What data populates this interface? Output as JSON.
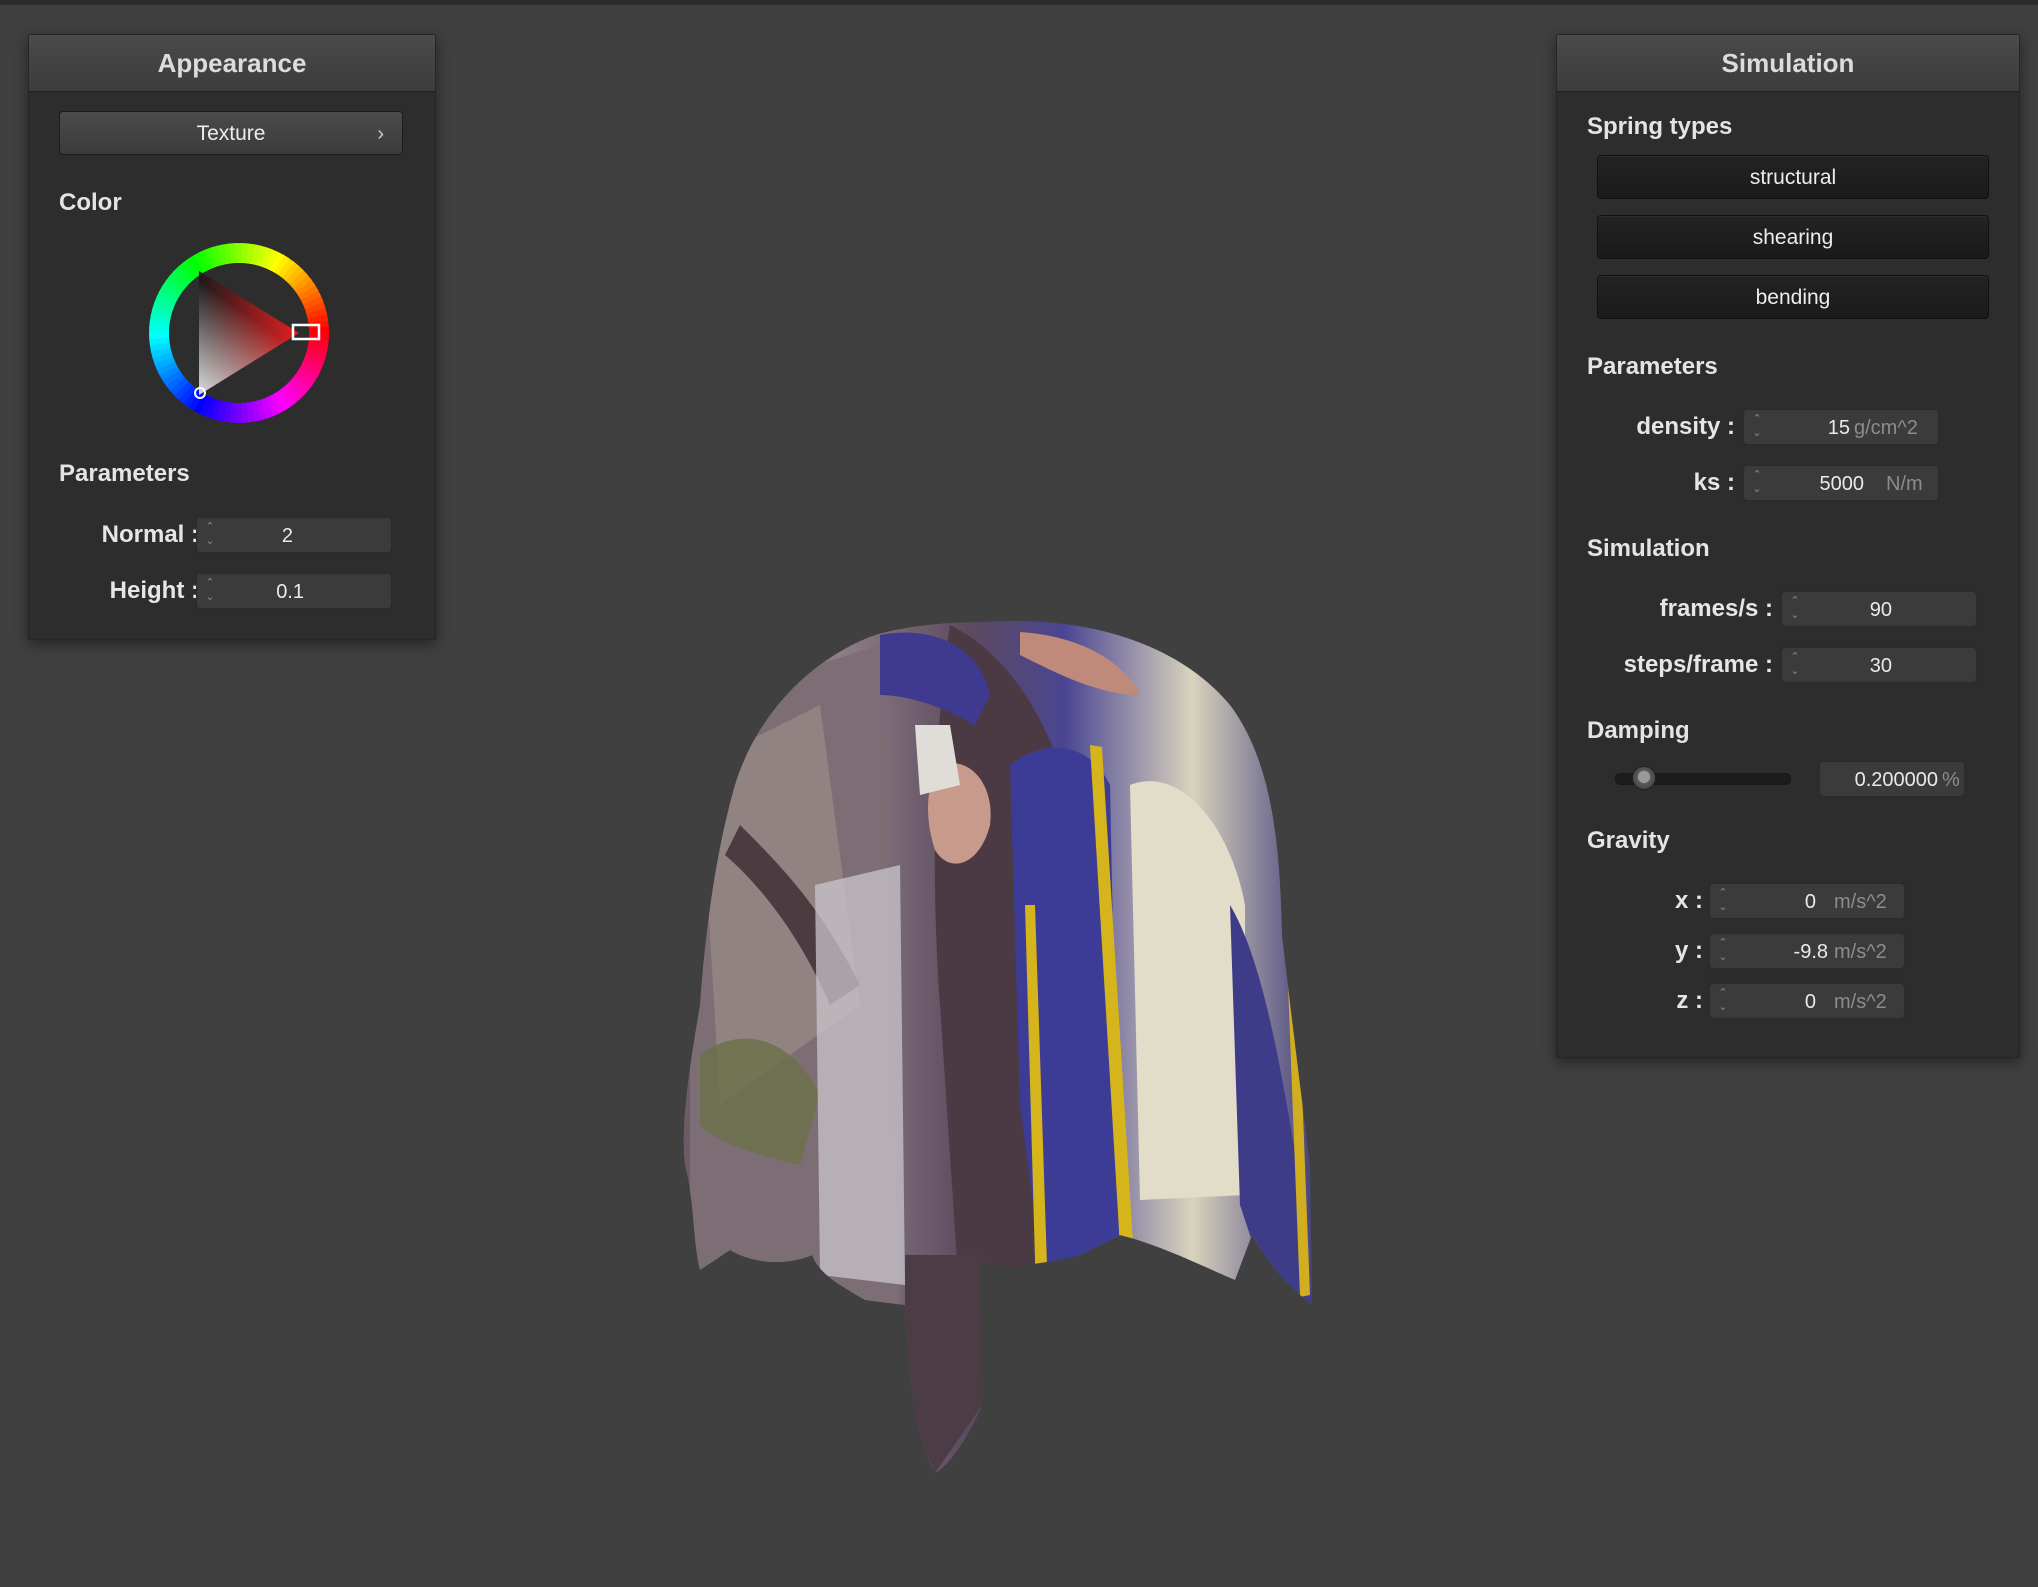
{
  "appearance_panel": {
    "title": "Appearance",
    "texture_button": "Texture",
    "color_label": "Color",
    "parameters_label": "Parameters",
    "normal": {
      "label": "Normal :",
      "value": "2"
    },
    "height": {
      "label": "Height :",
      "value": "0.1"
    },
    "selected_color": "#e52020"
  },
  "simulation_panel": {
    "title": "Simulation",
    "spring_types_label": "Spring types",
    "spring_buttons": [
      "structural",
      "shearing",
      "bending"
    ],
    "parameters_label": "Parameters",
    "density": {
      "label": "density :",
      "value": "15",
      "unit": "g/cm^2"
    },
    "ks": {
      "label": "ks :",
      "value": "5000",
      "unit": "N/m"
    },
    "simulation_label": "Simulation",
    "frames_per_s": {
      "label": "frames/s :",
      "value": "90"
    },
    "steps_per_frame": {
      "label": "steps/frame :",
      "value": "30"
    },
    "damping_label": "Damping",
    "damping": {
      "value": "0.200000",
      "unit": "%",
      "slider_fraction": 0.2
    },
    "gravity_label": "Gravity",
    "gravity_x": {
      "label": "x :",
      "value": "0",
      "unit": "m/s^2"
    },
    "gravity_y": {
      "label": "y :",
      "value": "-9.8",
      "unit": "m/s^2"
    },
    "gravity_z": {
      "label": "z :",
      "value": "0",
      "unit": "m/s^2"
    }
  },
  "viewport": {
    "background": "#404040",
    "cloth_colors": [
      "#5a4a78",
      "#3a3a8c",
      "#d4b020",
      "#e8e2cf",
      "#6e5a60",
      "#a08890"
    ]
  }
}
